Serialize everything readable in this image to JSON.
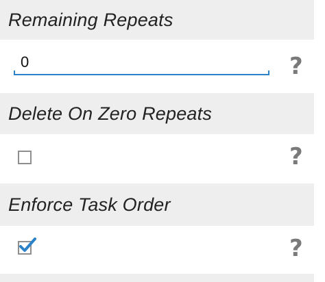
{
  "sections": [
    {
      "title": "Remaining Repeats",
      "control": "text-input",
      "value": "0"
    },
    {
      "title": "Delete On Zero Repeats",
      "control": "checkbox",
      "checked": false
    },
    {
      "title": "Enforce Task Order",
      "control": "checkbox",
      "checked": true
    }
  ],
  "help_label": "?",
  "icons": {
    "help": "question-mark-icon",
    "check": "checkmark-icon"
  },
  "colors": {
    "header_bg": "#eeeeee",
    "accent": "#2b82c8",
    "help_icon": "#7a7a7a",
    "checkbox_border": "#8f8f8f"
  }
}
